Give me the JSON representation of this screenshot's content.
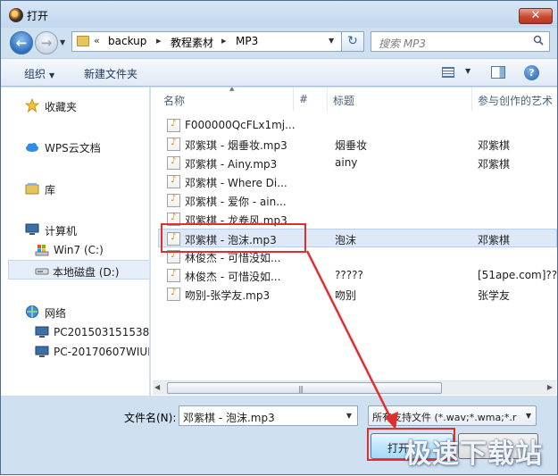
{
  "window": {
    "title": "打开",
    "close_glyph": "✕"
  },
  "nav": {
    "back_glyph": "←",
    "forward_glyph": "→",
    "breadcrumb": [
      "backup",
      "教程素材",
      "MP3"
    ],
    "breadcrumb_prefix": "«",
    "search_placeholder": "搜索 MP3",
    "refresh_glyph": "↻"
  },
  "toolbar": {
    "organize": "组织",
    "new_folder": "新建文件夹",
    "help_glyph": "?"
  },
  "sidebar": {
    "items": [
      {
        "label": "收藏夹",
        "icon": "star-icon"
      },
      {
        "label": "WPS云文档",
        "icon": "cloud-icon"
      },
      {
        "label": "库",
        "icon": "library-icon"
      },
      {
        "label": "计算机",
        "icon": "computer-icon"
      },
      {
        "label": "Win7 (C:)",
        "icon": "drive-icon"
      },
      {
        "label": "本地磁盘 (D:)",
        "icon": "drive-icon"
      },
      {
        "label": "网络",
        "icon": "network-icon"
      },
      {
        "label": "PC201503151538",
        "icon": "pc-icon"
      },
      {
        "label": "PC-20170607WIUN",
        "icon": "pc-icon"
      }
    ]
  },
  "filelist": {
    "columns": [
      "名称",
      "#",
      "标题",
      "参与创作的艺术"
    ],
    "rows": [
      {
        "name": "F000000QcFLx1mj...",
        "title": "",
        "artist": ""
      },
      {
        "name": "邓紫琪 - 烟垂妆.mp3",
        "title": "烟垂妆",
        "artist": "邓紫棋"
      },
      {
        "name": "邓紫棋 - Ainy.mp3",
        "title": "ainy",
        "artist": "邓紫棋"
      },
      {
        "name": "邓紫棋 - Where Di...",
        "title": "",
        "artist": ""
      },
      {
        "name": "邓紫棋 - 爱你 - ain...",
        "title": "",
        "artist": ""
      },
      {
        "name": "邓紫棋 - 龙卷风.mp3",
        "title": "",
        "artist": ""
      },
      {
        "name": "邓紫棋 - 泡沫.mp3",
        "title": "泡沫",
        "artist": "邓紫棋"
      },
      {
        "name": "林俊杰 - 可惜没如...",
        "title": "",
        "artist": ""
      },
      {
        "name": "林俊杰 - 可惜没如...",
        "title": "?????",
        "artist": "[51ape.com]??"
      },
      {
        "name": "吻别-张学友.mp3",
        "title": "吻别",
        "artist": "张学友"
      }
    ],
    "selected_index": 6
  },
  "footer": {
    "filename_label": "文件名(N):",
    "filename_value": "邓紫棋 - 泡沫.mp3",
    "filetype_value": "所有支持文件 (*.wav;*.wma;*.r",
    "open_label": "打开(",
    "cancel_label": ""
  },
  "watermark": "极速下载站",
  "colors": {
    "highlight": "#e22d2d",
    "selection": "#dde9f7"
  }
}
